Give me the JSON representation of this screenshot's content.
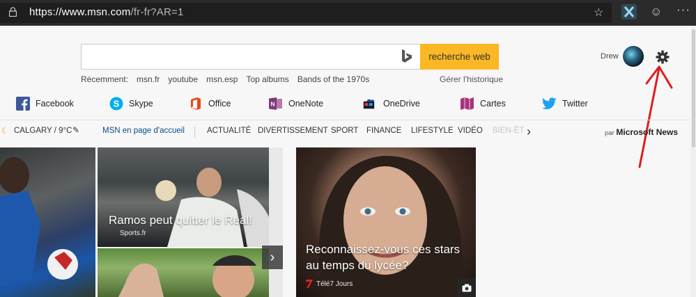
{
  "browser": {
    "url_host": "https://www.msn.com",
    "url_path": "/fr-fr?AR=1"
  },
  "search": {
    "value": "",
    "button_label": "recherche web",
    "recent_label": "Récemment:",
    "recent_items": [
      "msn.fr",
      "youtube",
      "msn.esp",
      "Top albums",
      "Bands of the 1970s"
    ],
    "history_link": "Gérer l'historique"
  },
  "user": {
    "name": "Drew"
  },
  "quicklinks": [
    {
      "label": "Facebook",
      "icon": "facebook-icon",
      "color": "#3b5998"
    },
    {
      "label": "Skype",
      "icon": "skype-icon",
      "color": "#00aff0"
    },
    {
      "label": "Office",
      "icon": "office-icon",
      "color": "#e64a19"
    },
    {
      "label": "OneNote",
      "icon": "onenote-icon",
      "color": "#80397b"
    },
    {
      "label": "OneDrive",
      "icon": "onedrive-icon",
      "color": "#094ab2"
    },
    {
      "label": "Cartes",
      "icon": "maps-icon",
      "color": "#a8327f"
    },
    {
      "label": "Twitter",
      "icon": "twitter-icon",
      "color": "#1da1f2"
    }
  ],
  "nav": {
    "weather": "CALGARY / 9°C",
    "home": "MSN en page d'accueil",
    "items": [
      "ACTUALITÉ",
      "DIVERTISSEMENT",
      "SPORT",
      "FINANCE",
      "LIFESTYLE",
      "VIDÉO",
      "BIEN-ÊT"
    ],
    "by": "par",
    "brand": "Microsoft News"
  },
  "tiles": {
    "ramos": {
      "headline": "Ramos peut quitter le Real!",
      "source": "Sports.fr"
    },
    "stars": {
      "headline_line1": "Reconnaissez-vous ces stars",
      "headline_line2": "au temps du lycée?",
      "source": "Télé7 Jours"
    }
  },
  "colors": {
    "accent": "#fbb724",
    "annotation": "#e01c1c",
    "link": "#0b4c8c"
  }
}
